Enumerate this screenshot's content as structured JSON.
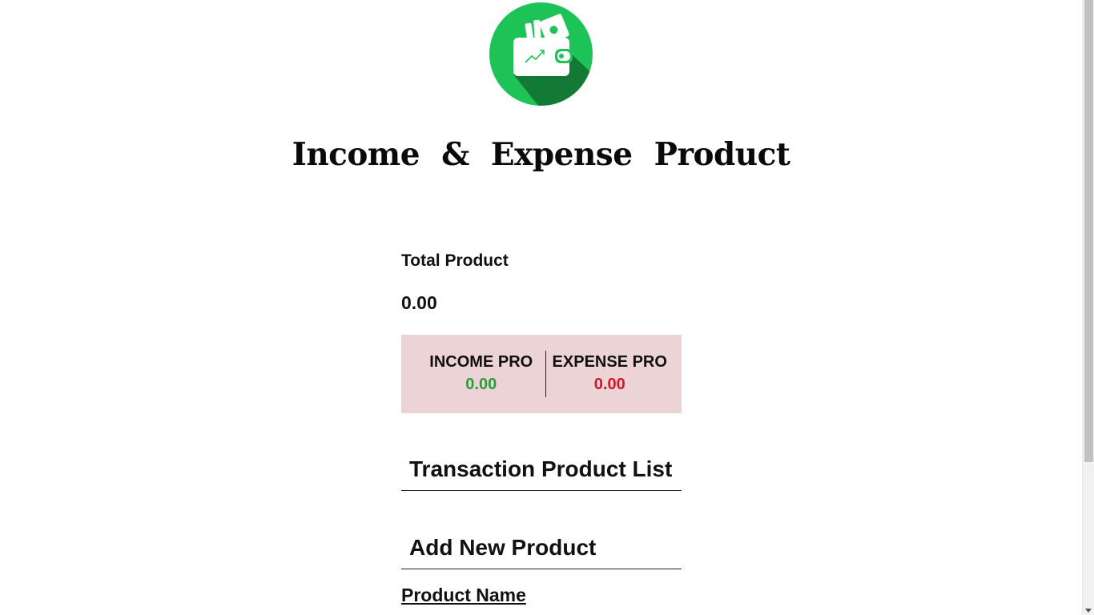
{
  "header": {
    "logo_icon": "wallet-money-icon",
    "title": "Income  &  Expense  Product"
  },
  "summary": {
    "total_label": "Total Product",
    "total_value": "0.00",
    "income_label": "INCOME PRO",
    "income_value": "0.00",
    "expense_label": "EXPENSE PRO",
    "expense_value": "0.00"
  },
  "transactions": {
    "heading": "Transaction Product List",
    "items": []
  },
  "add_form": {
    "heading": "Add New Product",
    "product_name_label": "Product Name"
  },
  "colors": {
    "logo_green": "#1dc357",
    "logo_shadow": "#137a35",
    "summary_bg": "#ecd3d5",
    "income": "#2a9d3f",
    "expense": "#d8152a"
  }
}
